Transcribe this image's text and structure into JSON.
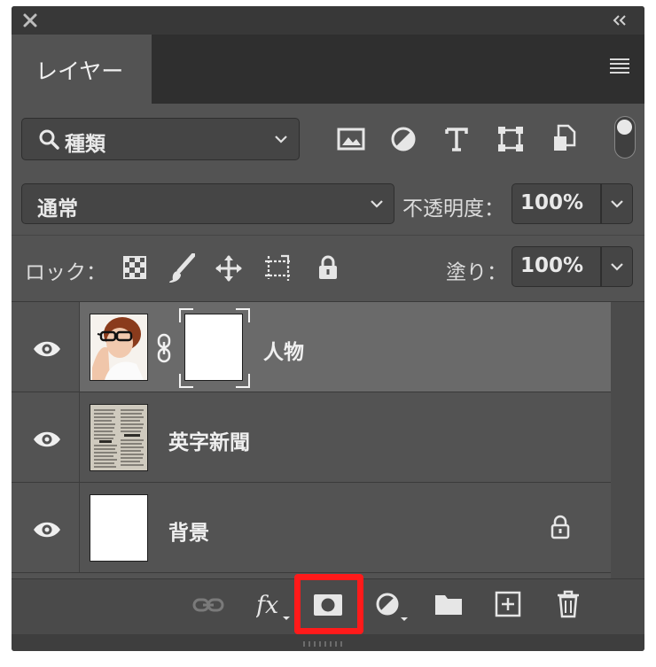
{
  "panel": {
    "tab_label": "レイヤー"
  },
  "filter": {
    "label": "種類"
  },
  "blend": {
    "mode": "通常",
    "opacity_label": "不透明度：",
    "opacity_value": "100%"
  },
  "lock": {
    "label": "ロック：",
    "fill_label": "塗り：",
    "fill_value": "100%"
  },
  "layers": [
    {
      "name": "人物",
      "selected": true,
      "has_mask": true
    },
    {
      "name": "英字新聞",
      "selected": false,
      "has_mask": false
    },
    {
      "name": "背景",
      "selected": false,
      "locked": true
    }
  ],
  "icons": {
    "close": "close-icon",
    "collapse": "collapse-icon",
    "menu": "hamburger-menu-icon",
    "search": "search-icon",
    "link": "link-layers-icon",
    "fx": "layer-style-fx-icon",
    "mask": "add-mask-icon",
    "adjust": "adjustment-layer-icon",
    "folder": "new-group-icon",
    "new": "new-layer-icon",
    "trash": "delete-layer-icon"
  },
  "colors": {
    "panel": "#535353",
    "dark": "#383838",
    "selected_row": "#6a6a6a",
    "highlight": "#ff1a1a"
  }
}
